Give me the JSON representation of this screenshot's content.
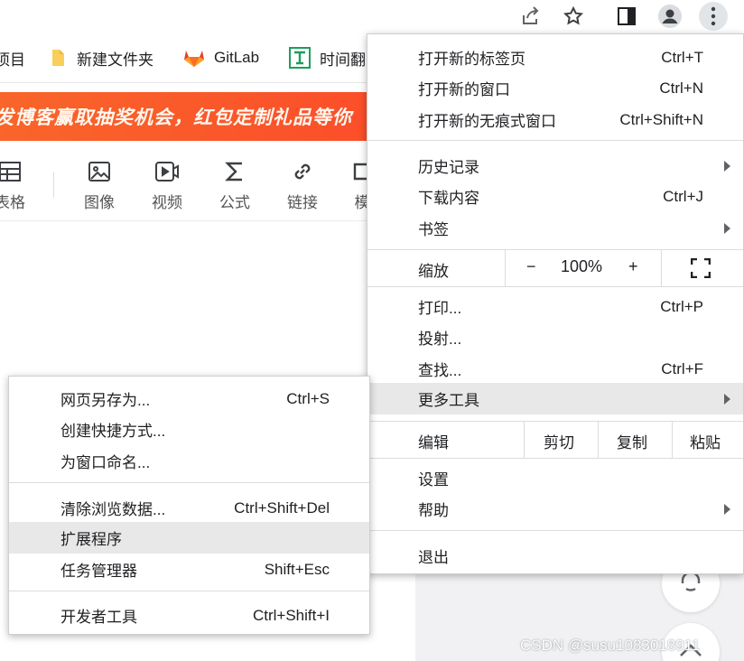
{
  "toolbar": {
    "share_icon": "share-icon",
    "star_icon": "star-icon",
    "side_panel_icon": "side-panel-icon",
    "profile_icon": "profile-icon",
    "menu_icon": "kebab-menu-icon"
  },
  "bookmarks": [
    {
      "label": "项目",
      "icon": "none"
    },
    {
      "label": "新建文件夹",
      "icon": "folder-icon"
    },
    {
      "label": "GitLab",
      "icon": "gitlab-icon"
    },
    {
      "label": "时间翻",
      "icon": "document-icon"
    }
  ],
  "banner": {
    "text": "发博客赢取抽奖机会，红包定制礼品等你"
  },
  "editor_toolbar": {
    "items": [
      {
        "label": "表格",
        "icon": "table-icon"
      },
      {
        "label": "图像",
        "icon": "image-icon"
      },
      {
        "label": "视频",
        "icon": "video-icon"
      },
      {
        "label": "公式",
        "icon": "sigma-icon"
      },
      {
        "label": "链接",
        "icon": "link-icon"
      },
      {
        "label": "模",
        "icon": "template-icon"
      }
    ]
  },
  "main_menu": {
    "new_tab": {
      "label": "打开新的标签页",
      "shortcut": "Ctrl+T"
    },
    "new_window": {
      "label": "打开新的窗口",
      "shortcut": "Ctrl+N"
    },
    "incognito": {
      "label": "打开新的无痕式窗口",
      "shortcut": "Ctrl+Shift+N"
    },
    "history": {
      "label": "历史记录"
    },
    "downloads": {
      "label": "下载内容",
      "shortcut": "Ctrl+J"
    },
    "bookmarks": {
      "label": "书签"
    },
    "zoom": {
      "label": "缩放",
      "minus": "−",
      "value": "100%",
      "plus": "+"
    },
    "print": {
      "label": "打印...",
      "shortcut": "Ctrl+P"
    },
    "cast": {
      "label": "投射..."
    },
    "find": {
      "label": "查找...",
      "shortcut": "Ctrl+F"
    },
    "more_tools": {
      "label": "更多工具"
    },
    "edit": {
      "label": "编辑",
      "cut": "剪切",
      "copy": "复制",
      "paste": "粘贴"
    },
    "settings": {
      "label": "设置"
    },
    "help": {
      "label": "帮助"
    },
    "exit": {
      "label": "退出"
    }
  },
  "sub_menu": {
    "save_page": {
      "label": "网页另存为...",
      "shortcut": "Ctrl+S"
    },
    "create_shortcut": {
      "label": "创建快捷方式..."
    },
    "name_window": {
      "label": "为窗口命名..."
    },
    "clear_data": {
      "label": "清除浏览数据...",
      "shortcut": "Ctrl+Shift+Del"
    },
    "extensions": {
      "label": "扩展程序"
    },
    "task_manager": {
      "label": "任务管理器",
      "shortcut": "Shift+Esc"
    },
    "dev_tools": {
      "label": "开发者工具",
      "shortcut": "Ctrl+Shift+I"
    }
  },
  "watermark": "CSDN @susu1083018911",
  "colors": {
    "banner": "#fb4e2a",
    "highlight": "#e8e8e8",
    "gitlab": "#e24329",
    "folder": "#f7cf5a"
  }
}
